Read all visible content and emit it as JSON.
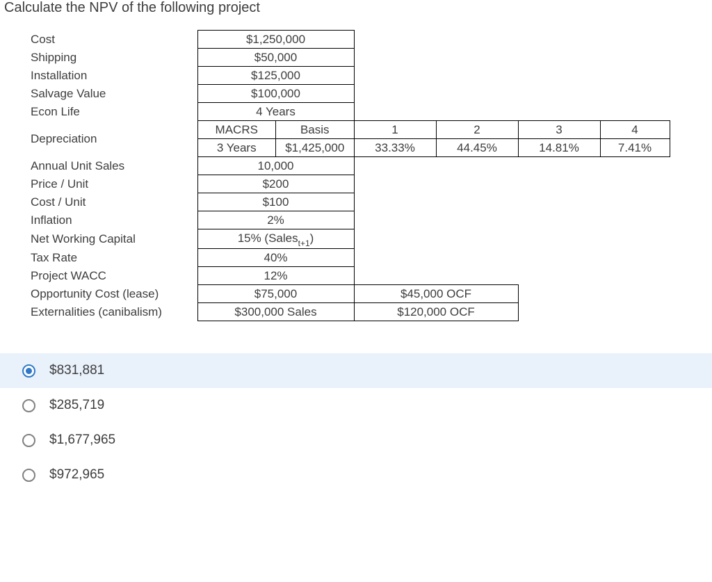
{
  "title": "Calculate the NPV of the following project",
  "rows": {
    "cost": {
      "label": "Cost",
      "value": "$1,250,000"
    },
    "shipping": {
      "label": "Shipping",
      "value": "$50,000"
    },
    "installation": {
      "label": "Installation",
      "value": "$125,000"
    },
    "salvage": {
      "label": "Salvage Value",
      "value": "$100,000"
    },
    "econlife": {
      "label": "Econ Life",
      "value": "4 Years"
    },
    "depreciation": {
      "label": "Depreciation",
      "macrs_header": "MACRS",
      "basis_header": "Basis",
      "macrs_value": "3 Years",
      "basis_value": "$1,425,000",
      "years": [
        "1",
        "2",
        "3",
        "4"
      ],
      "percents": [
        "33.33%",
        "44.45%",
        "14.81%",
        "7.41%"
      ]
    },
    "annualunits": {
      "label": "Annual Unit Sales",
      "value": "10,000"
    },
    "price": {
      "label": "Price / Unit",
      "value": "$200"
    },
    "costunit": {
      "label": "Cost / Unit",
      "value": "$100"
    },
    "inflation": {
      "label": "Inflation",
      "value": "2%"
    },
    "nwc": {
      "label": "Net Working Capital",
      "value_prefix": "15% (Sales",
      "value_sub": "t+1",
      "value_suffix": ")"
    },
    "tax": {
      "label": "Tax Rate",
      "value": "40%"
    },
    "wacc": {
      "label": "Project WACC",
      "value": "12%"
    },
    "opp": {
      "label": "Opportunity Cost (lease)",
      "value": "$75,000",
      "extra": "$45,000 OCF"
    },
    "ext": {
      "label": "Externalities (canibalism)",
      "value": "$300,000 Sales",
      "extra": "$120,000 OCF"
    }
  },
  "answers": [
    {
      "label": "$831,881",
      "selected": true
    },
    {
      "label": "$285,719",
      "selected": false
    },
    {
      "label": "$1,677,965",
      "selected": false
    },
    {
      "label": "$972,965",
      "selected": false
    }
  ]
}
